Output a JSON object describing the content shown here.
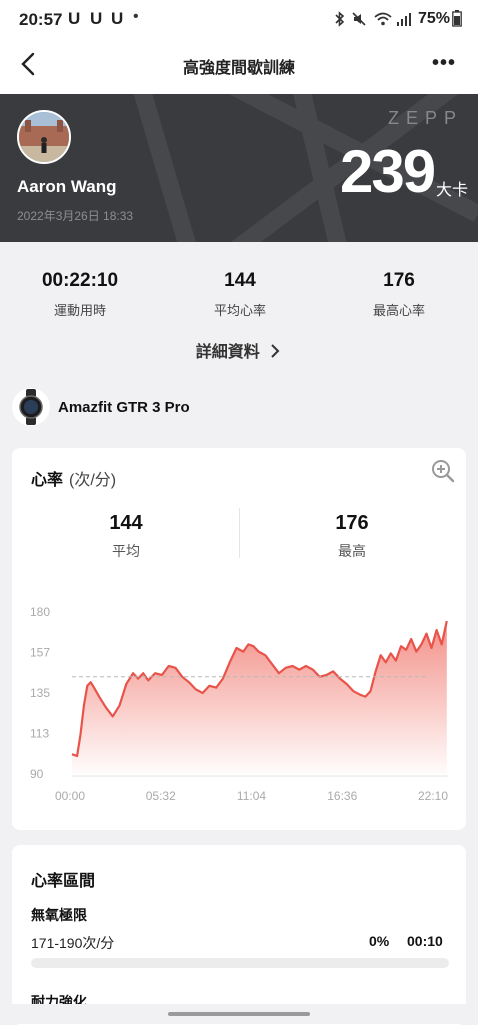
{
  "status_bar": {
    "time": "20:57",
    "notif_icons": [
      "U",
      "U",
      "U"
    ],
    "dot": "•",
    "battery": "75%"
  },
  "app_bar": {
    "title": "高強度間歇訓練",
    "more": "•••"
  },
  "hero": {
    "brand": "ZEPP",
    "user_name": "Aaron Wang",
    "datetime": "2022年3月26日 18:33",
    "calories": "239",
    "calories_unit": "大卡"
  },
  "summary": {
    "stats": [
      {
        "value": "00:22:10",
        "label": "運動用時"
      },
      {
        "value": "144",
        "label": "平均心率"
      },
      {
        "value": "176",
        "label": "最高心率"
      }
    ],
    "details_link": "詳細資料"
  },
  "device": {
    "name": "Amazfit GTR 3 Pro"
  },
  "heart_rate": {
    "title": "心率",
    "unit": "(次/分)",
    "avg": {
      "value": "144",
      "label": "平均"
    },
    "max": {
      "value": "176",
      "label": "最高"
    }
  },
  "chart_data": {
    "type": "area",
    "y_ticks": [
      "180",
      "157",
      "135",
      "113",
      "90"
    ],
    "x_ticks": [
      "00:00",
      "05:32",
      "11:04",
      "16:36",
      "22:10"
    ],
    "ylim": [
      90,
      180
    ],
    "xlim_minutes": [
      0,
      22.17
    ],
    "avg_line": 144,
    "series": [
      {
        "x": [
          0,
          0.3,
          0.5,
          0.7,
          0.9,
          1.1,
          1.3,
          1.6,
          2.0,
          2.4,
          2.8,
          3.2,
          3.6,
          3.9,
          4.2,
          4.5,
          4.9,
          5.3,
          5.7,
          6.1,
          6.5,
          6.9,
          7.3,
          7.7,
          8.1,
          8.5,
          8.9,
          9.3,
          9.7,
          10.1,
          10.4,
          10.7,
          11.0,
          11.4,
          11.8,
          12.2,
          12.6,
          13.0,
          13.4,
          13.8,
          14.2,
          14.6,
          15.0,
          15.4,
          15.8,
          16.2,
          16.6,
          17.0,
          17.3,
          17.6,
          17.9,
          18.2,
          18.5,
          18.8,
          19.1,
          19.4,
          19.7,
          20.0,
          20.3,
          20.6,
          20.9,
          21.2,
          21.5,
          21.8,
          22.1
        ],
        "y": [
          101,
          100,
          112,
          128,
          139,
          141,
          138,
          133,
          127,
          122,
          128,
          140,
          146,
          143,
          146,
          142,
          146,
          145,
          150,
          149,
          144,
          141,
          137,
          135,
          139,
          138,
          143,
          152,
          160,
          158,
          162,
          161,
          158,
          156,
          151,
          146,
          149,
          150,
          148,
          150,
          148,
          144,
          145,
          147,
          143,
          140,
          136,
          134,
          133,
          136,
          147,
          156,
          152,
          157,
          153,
          161,
          159,
          165,
          158,
          162,
          168,
          160,
          170,
          162,
          175
        ]
      }
    ]
  },
  "zones": {
    "title": "心率區間",
    "items": [
      {
        "name": "無氧極限",
        "range": "171-190次/分",
        "percent": "0%",
        "time": "00:10",
        "fill": 0
      }
    ],
    "next_name": "耐力強化"
  },
  "colors": {
    "accent": "#e8534a",
    "hero_bg": "#3a3b3e"
  }
}
